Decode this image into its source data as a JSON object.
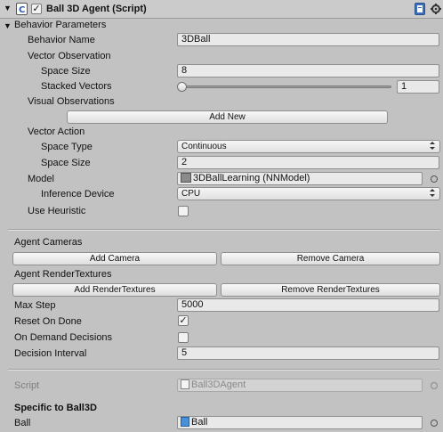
{
  "component": {
    "title": "Ball 3D Agent (Script)",
    "enabled": true
  },
  "behavior_parameters": {
    "section_label": "Behavior Parameters",
    "behavior_name_label": "Behavior Name",
    "behavior_name": "3DBall",
    "vector_observation_label": "Vector Observation",
    "space_size_label": "Space Size",
    "obs_space_size": "8",
    "stacked_vectors_label": "Stacked Vectors",
    "stacked_vectors": "1",
    "stacked_vectors_slider_fraction": 0.0,
    "visual_observations_label": "Visual Observations",
    "add_new_label": "Add New",
    "vector_action_label": "Vector Action",
    "space_type_label": "Space Type",
    "space_type": "Continuous",
    "action_space_size_label": "Space Size",
    "action_space_size": "2",
    "model_label": "Model",
    "model": "3DBallLearning (NNModel)",
    "inference_device_label": "Inference Device",
    "inference_device": "CPU",
    "use_heuristic_label": "Use Heuristic",
    "use_heuristic": false
  },
  "agent": {
    "agent_cameras_label": "Agent Cameras",
    "add_camera_label": "Add Camera",
    "remove_camera_label": "Remove Camera",
    "agent_render_textures_label": "Agent RenderTextures",
    "add_render_textures_label": "Add RenderTextures",
    "remove_render_textures_label": "Remove RenderTextures",
    "max_step_label": "Max Step",
    "max_step": "5000",
    "reset_on_done_label": "Reset On Done",
    "reset_on_done": true,
    "on_demand_label": "On Demand Decisions",
    "on_demand": false,
    "decision_interval_label": "Decision Interval",
    "decision_interval": "5"
  },
  "script": {
    "label": "Script",
    "value": "Ball3DAgent"
  },
  "specific": {
    "heading": "Specific to Ball3D",
    "ball_label": "Ball",
    "ball_value": "Ball"
  },
  "icons": {
    "check_glyph": "✓",
    "fold_down_glyph": "▼",
    "fold_right_glyph": "▶",
    "dropdown_glyph": "▲▼"
  },
  "colors": {
    "background": "#c2c2c2",
    "field": "#e9e9e9",
    "script_icon": "#3a7bd5"
  }
}
